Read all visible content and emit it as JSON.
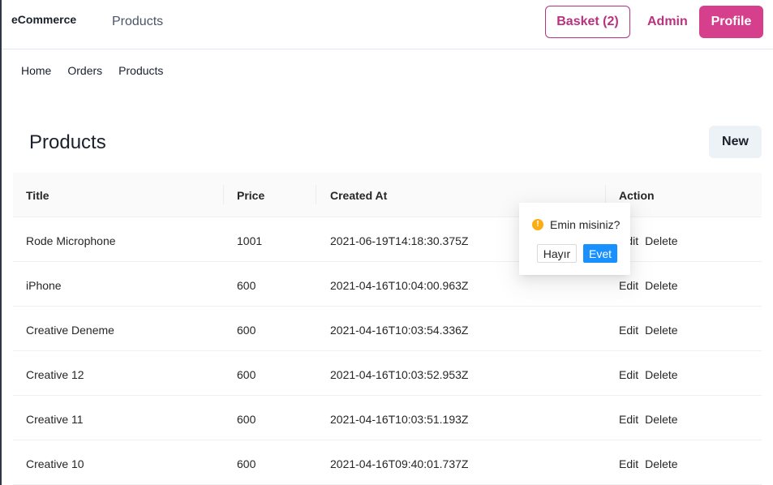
{
  "header": {
    "brand": "eCommerce",
    "nav_products": "Products",
    "basket_label": "Basket (2)",
    "admin_label": "Admin",
    "profile_label": "Profile"
  },
  "subnav": {
    "items": [
      "Home",
      "Orders",
      "Products"
    ]
  },
  "page": {
    "title": "Products",
    "new_label": "New"
  },
  "table": {
    "columns": [
      "Title",
      "Price",
      "Created At",
      "Action"
    ],
    "rows": [
      {
        "title": "Rode Microphone",
        "price": "1001",
        "created_at": "2021-06-19T14:18:30.375Z"
      },
      {
        "title": "iPhone",
        "price": "600",
        "created_at": "2021-04-16T10:04:00.963Z"
      },
      {
        "title": "Creative Deneme",
        "price": "600",
        "created_at": "2021-04-16T10:03:54.336Z"
      },
      {
        "title": "Creative 12",
        "price": "600",
        "created_at": "2021-04-16T10:03:52.953Z"
      },
      {
        "title": "Creative 11",
        "price": "600",
        "created_at": "2021-04-16T10:03:51.193Z"
      },
      {
        "title": "Creative 10",
        "price": "600",
        "created_at": "2021-04-16T09:40:01.737Z"
      }
    ],
    "edit_label": "Edit",
    "delete_label": "Delete"
  },
  "popconfirm": {
    "icon": "exclamation-circle-icon",
    "message": "Emin misiniz?",
    "cancel_label": "Hayır",
    "ok_label": "Evet"
  },
  "colors": {
    "brand_pink": "#d53f8c",
    "brand_pink_dark": "#b83280",
    "confirm_blue": "#1890ff",
    "warning_orange": "#faad14"
  }
}
